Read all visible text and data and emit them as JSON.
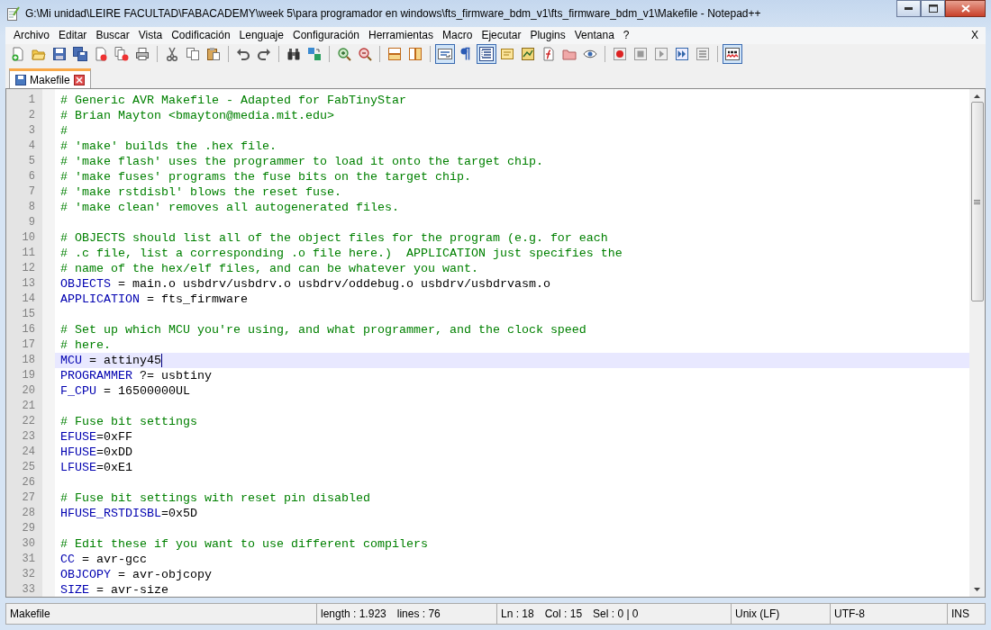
{
  "window": {
    "title": "G:\\Mi unidad\\LEIRE FACULTAD\\FABACADEMY\\week 5\\para programador en windows\\fts_firmware_bdm_v1\\fts_firmware_bdm_v1\\Makefile - Notepad++"
  },
  "menu": [
    "Archivo",
    "Editar",
    "Buscar",
    "Vista",
    "Codificación",
    "Lenguaje",
    "Configuración",
    "Herramientas",
    "Macro",
    "Ejecutar",
    "Plugins",
    "Ventana",
    "?"
  ],
  "menu_close": "X",
  "toolbar_groups": [
    {
      "buttons": [
        {
          "kind": "new",
          "pressed": false
        },
        {
          "kind": "open",
          "pressed": false
        },
        {
          "kind": "save",
          "pressed": false
        },
        {
          "kind": "saveall",
          "pressed": false
        },
        {
          "kind": "close",
          "pressed": false
        },
        {
          "kind": "closeall",
          "pressed": false
        },
        {
          "kind": "print",
          "pressed": false
        }
      ]
    },
    {
      "buttons": [
        {
          "kind": "cut",
          "pressed": false
        },
        {
          "kind": "copy",
          "pressed": false
        },
        {
          "kind": "paste",
          "pressed": false
        }
      ]
    },
    {
      "buttons": [
        {
          "kind": "undo",
          "pressed": false
        },
        {
          "kind": "redo",
          "pressed": false
        }
      ]
    },
    {
      "buttons": [
        {
          "kind": "find",
          "pressed": false
        },
        {
          "kind": "replace",
          "pressed": false
        }
      ]
    },
    {
      "buttons": [
        {
          "kind": "zoomin",
          "pressed": false
        },
        {
          "kind": "zoomout",
          "pressed": false
        }
      ]
    },
    {
      "buttons": [
        {
          "kind": "syncv",
          "pressed": false
        },
        {
          "kind": "synch",
          "pressed": false
        }
      ]
    },
    {
      "buttons": [
        {
          "kind": "wrap",
          "pressed": true
        },
        {
          "kind": "allchars",
          "pressed": false
        },
        {
          "kind": "indent",
          "pressed": true
        },
        {
          "kind": "udl",
          "pressed": false
        },
        {
          "kind": "docmap",
          "pressed": false
        },
        {
          "kind": "funclist",
          "pressed": false
        },
        {
          "kind": "folder",
          "pressed": false
        },
        {
          "kind": "monitor",
          "pressed": false
        }
      ]
    },
    {
      "buttons": [
        {
          "kind": "record",
          "pressed": false
        },
        {
          "kind": "stop",
          "pressed": false
        },
        {
          "kind": "play",
          "pressed": false
        },
        {
          "kind": "playmulti",
          "pressed": false
        },
        {
          "kind": "savemacro",
          "pressed": false
        }
      ]
    },
    {
      "buttons": [
        {
          "kind": "spell",
          "pressed": true
        }
      ]
    }
  ],
  "tabs": [
    {
      "label": "Makefile",
      "selected": true
    }
  ],
  "editor": {
    "lines": [
      {
        "number": "1",
        "kind": "comment",
        "text": "# Generic AVR Makefile - Adapted for FabTinyStar",
        "selected": false
      },
      {
        "number": "2",
        "kind": "comment",
        "text": "# Brian Mayton <bmayton@media.mit.edu>",
        "selected": false
      },
      {
        "number": "3",
        "kind": "comment",
        "text": "#",
        "selected": false
      },
      {
        "number": "4",
        "kind": "comment",
        "text": "# 'make' builds the .hex file.",
        "selected": false
      },
      {
        "number": "5",
        "kind": "comment",
        "text": "# 'make flash' uses the programmer to load it onto the target chip.",
        "selected": false
      },
      {
        "number": "6",
        "kind": "comment",
        "text": "# 'make fuses' programs the fuse bits on the target chip.",
        "selected": false
      },
      {
        "number": "7",
        "kind": "comment",
        "text": "# 'make rstdisbl' blows the reset fuse.",
        "selected": false
      },
      {
        "number": "8",
        "kind": "comment",
        "text": "# 'make clean' removes all autogenerated files.",
        "selected": false
      },
      {
        "number": "9",
        "kind": "blank",
        "selected": false
      },
      {
        "number": "10",
        "kind": "comment",
        "text": "# OBJECTS should list all of the object files for the program (e.g. for each",
        "selected": false
      },
      {
        "number": "11",
        "kind": "comment",
        "text": "# .c file, list a corresponding .o file here.)  APPLICATION just specifies the",
        "selected": false
      },
      {
        "number": "12",
        "kind": "comment",
        "text": "# name of the hex/elf files, and can be whatever you want.",
        "selected": false
      },
      {
        "number": "13",
        "kind": "assign",
        "name": "OBJECTS",
        "value": " = main.o usbdrv/usbdrv.o usbdrv/oddebug.o usbdrv/usbdrvasm.o",
        "selected": false
      },
      {
        "number": "14",
        "kind": "assign",
        "name": "APPLICATION",
        "value": " = fts_firmware",
        "selected": false
      },
      {
        "number": "15",
        "kind": "blank",
        "selected": false
      },
      {
        "number": "16",
        "kind": "comment",
        "text": "# Set up which MCU you're using, and what programmer, and the clock speed",
        "selected": false
      },
      {
        "number": "17",
        "kind": "comment",
        "text": "# here.",
        "selected": false
      },
      {
        "number": "18",
        "kind": "assign",
        "name": "MCU",
        "value": " = attiny45",
        "selected": true
      },
      {
        "number": "19",
        "kind": "assign",
        "name": "PROGRAMMER",
        "value": " ?= usbtiny",
        "selected": false
      },
      {
        "number": "20",
        "kind": "assign",
        "name": "F_CPU",
        "value": " = 16500000UL",
        "selected": false
      },
      {
        "number": "21",
        "kind": "blank",
        "selected": false
      },
      {
        "number": "22",
        "kind": "comment",
        "text": "# Fuse bit settings",
        "selected": false
      },
      {
        "number": "23",
        "kind": "assign",
        "name": "EFUSE",
        "value": "=0xFF",
        "selected": false
      },
      {
        "number": "24",
        "kind": "assign",
        "name": "HFUSE",
        "value": "=0xDD",
        "selected": false
      },
      {
        "number": "25",
        "kind": "assign",
        "name": "LFUSE",
        "value": "=0xE1",
        "selected": false
      },
      {
        "number": "26",
        "kind": "blank",
        "selected": false
      },
      {
        "number": "27",
        "kind": "comment",
        "text": "# Fuse bit settings with reset pin disabled",
        "selected": false
      },
      {
        "number": "28",
        "kind": "assign",
        "name": "HFUSE_RSTDISBL",
        "value": "=0x5D",
        "selected": false
      },
      {
        "number": "29",
        "kind": "blank",
        "selected": false
      },
      {
        "number": "30",
        "kind": "comment",
        "text": "# Edit these if you want to use different compilers",
        "selected": false
      },
      {
        "number": "31",
        "kind": "assign",
        "name": "CC",
        "value": " = avr-gcc",
        "selected": false
      },
      {
        "number": "32",
        "kind": "assign",
        "name": "OBJCOPY",
        "value": " = avr-objcopy",
        "selected": false
      },
      {
        "number": "33",
        "kind": "assign",
        "name": "SIZE",
        "value": " = avr-size",
        "selected": false
      }
    ]
  },
  "status_bar": {
    "file_type": "Makefile",
    "length": "length : 1.923",
    "lines": "lines : 76",
    "ln": "Ln : 18",
    "col": "Col : 15",
    "sel": "Sel : 0 | 0",
    "eol": "Unix (LF)",
    "encoding": "UTF-8",
    "mode": "INS"
  }
}
